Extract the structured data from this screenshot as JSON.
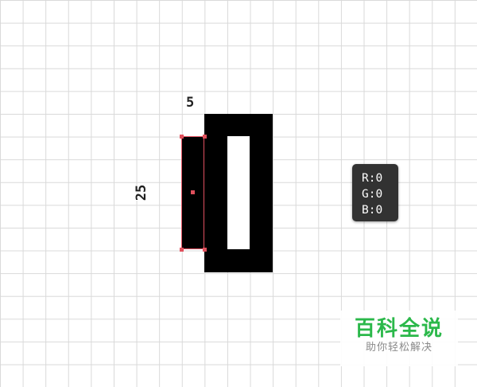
{
  "canvas": {
    "dimensions": {
      "width_label": "5",
      "height_label": "25"
    },
    "color_readout": {
      "r": "R:0",
      "g": "G:0",
      "b": "B:0"
    }
  },
  "watermark": {
    "title": "百科全说",
    "subtitle": "助你轻松解决"
  },
  "colors": {
    "shape_fill": "#000000",
    "selection": "#e0505c",
    "grid": "#d9d9d9",
    "watermark_green": "#2bb84a"
  }
}
